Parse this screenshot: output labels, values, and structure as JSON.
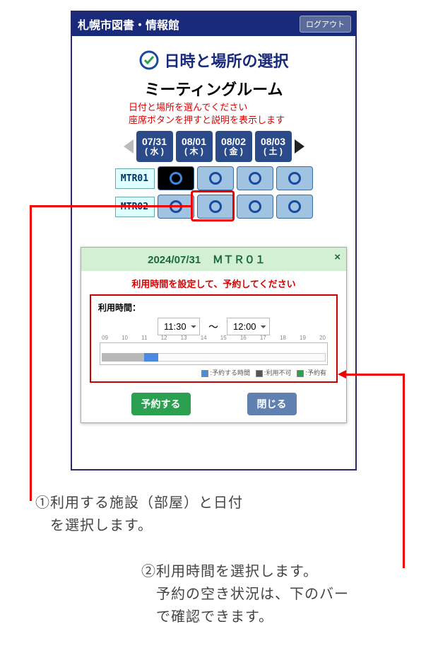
{
  "topbar": {
    "title": "札幌市図書・情報館",
    "logout": "ログアウト"
  },
  "heading": "日時と場所の選択",
  "section_title": "ミーティングルーム",
  "hint1": "日付と場所を選んでください",
  "hint2": "座席ボタンを押すと説明を表示します",
  "dates": [
    {
      "date": "07/31",
      "dow": "( 水 )"
    },
    {
      "date": "08/01",
      "dow": "( 木 )"
    },
    {
      "date": "08/02",
      "dow": "( 金 )"
    },
    {
      "date": "08/03",
      "dow": "( 土 )"
    }
  ],
  "rooms": [
    "MTR01",
    "MTR02"
  ],
  "panel": {
    "header_date": "2024/07/31",
    "header_room": "ＭＴＲ０１",
    "hint": "利用時間を設定して、予約してください",
    "time_label": "利用時間：",
    "start": "11:30",
    "end": "12:00",
    "ticks": [
      "09",
      "10",
      "11",
      "12",
      "13",
      "14",
      "15",
      "16",
      "17",
      "18",
      "19",
      "20"
    ],
    "legend": {
      "sel": ":予約する時間",
      "na": ":利用不可",
      "has": ":予約有"
    },
    "reserve": "予約する",
    "close": "閉じる"
  },
  "captions": {
    "c1a": "①利用する施設（部屋）と日付",
    "c1b": "　を選択します。",
    "c2a": "②利用時間を選択します。",
    "c2b": "　予約の空き状況は、下のバー",
    "c2c": "　で確認できます。"
  }
}
